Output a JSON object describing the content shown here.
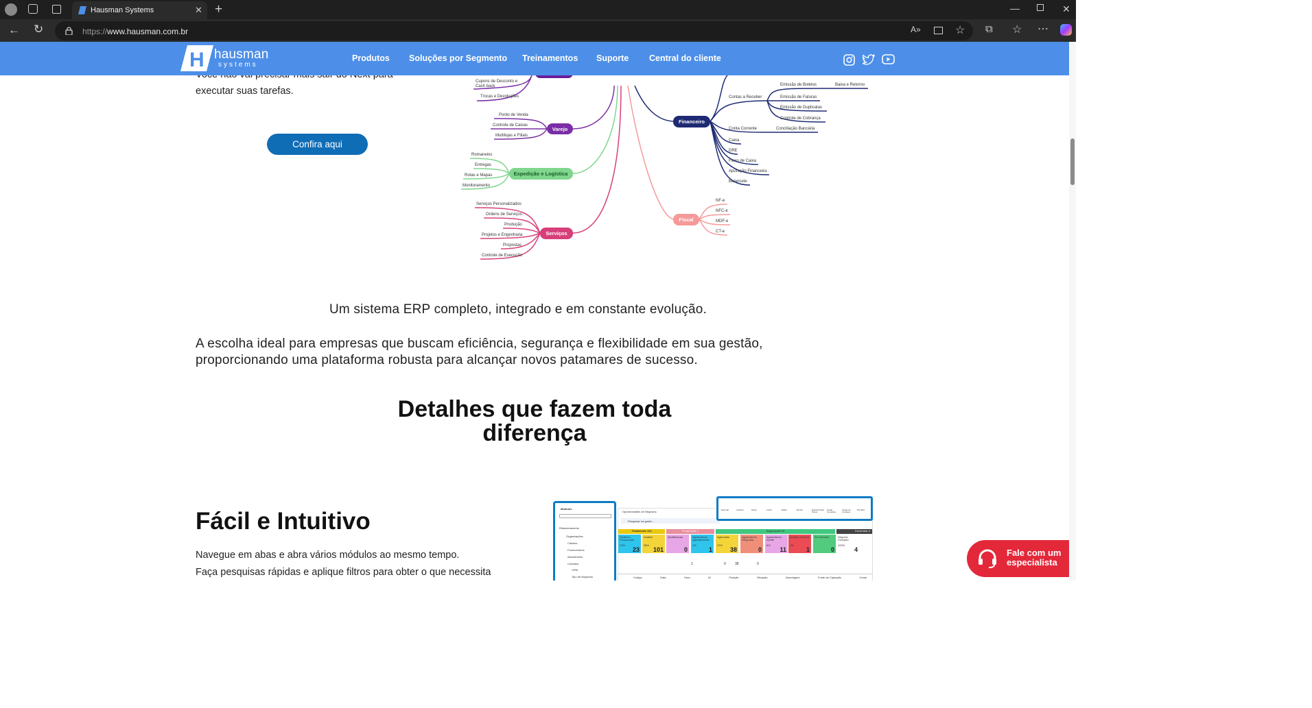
{
  "browser": {
    "tab_title": "Hausman Systems",
    "url_scheme": "https://",
    "url_host": "www.hausman.com.br"
  },
  "nav": {
    "logo_name": "hausman",
    "logo_sub": "systems",
    "items": [
      "Produtos",
      "Soluções por Segmento",
      "Treinamentos",
      "Suporte",
      "Central do cliente"
    ],
    "social": [
      "instagram-icon",
      "twitter-icon",
      "youtube-icon"
    ]
  },
  "intro": {
    "line1": "Você não vai precisar mais sair do Next para",
    "line2": "executar suas tarefas.",
    "button": "Confira aqui"
  },
  "mindmap": {
    "left_top_items": [
      "Cupons de Desconto e",
      "Cash back",
      "Trocas e Devoluções"
    ],
    "varejo": {
      "label": "Varejo",
      "items": [
        "Ponto de Venda",
        "Controle de Caixas",
        "Multilojas e Filiais"
      ]
    },
    "expedicao": {
      "label": "Expedição e Logística",
      "items": [
        "Romaneios",
        "Entregas",
        "Rotas e Mapas",
        "Monitoramento"
      ]
    },
    "servicos": {
      "label": "Serviços",
      "items": [
        "Serviços Personalizados",
        "Ordens de Serviços",
        "Produção",
        "Projetos e Engenharia",
        "Propostas",
        "Controle de Execução"
      ]
    },
    "financeiro": {
      "label": "Financeiro",
      "receber": "Contas a Receber",
      "receber_items": [
        "Emissão de Boletos",
        "Emissão de Faturas",
        "Emissão de Duplicatas",
        "Controle de Cobrança"
      ],
      "baixa": "Baixa e Retorno",
      "conta_corrente": "Conta Corrente",
      "conciliacao": "Conciliação Bancária",
      "items": [
        "Caixa",
        "DRE",
        "Fluxo de Caixa",
        "Apuração Financeira",
        "Balancete"
      ]
    },
    "fiscal": {
      "label": "Fiscal",
      "items": [
        "NF-e",
        "NFC-e",
        "MDF-e",
        "CT-e"
      ]
    }
  },
  "content": {
    "lead1": "Um sistema ERP completo, integrado e em constante evolução.",
    "lead2a": "A escolha ideal para empresas que buscam eficiência, segurança e flexibilidade em sua gestão,",
    "lead2b": "proporcionando uma plataforma robusta para alcançar novos patamares de sucesso.",
    "heading1": "Detalhes que fazem toda",
    "heading2": "diferença",
    "feature_title": "Fácil e Intuitivo",
    "feature_p1": "Navegue em abas e abra vários módulos ao mesmo tempo.",
    "feature_p2": "Faça pesquisas rápidas e aplique filtros para obter o que necessita"
  },
  "screenshot": {
    "modules_title": "Módulos",
    "tree": [
      "Relacionamento",
      "Organizações",
      "Clientes",
      "Fornecedores",
      "Atendimento",
      "Contatos",
      "CRM",
      "Tipo de Negócios"
    ],
    "tab": "Oportunidades de Negócios",
    "search": "Pesquisar na grade...",
    "toolbar": [
      "Exportar",
      "Imprimir",
      "Filtrar",
      "Incluir",
      "Editar",
      "Excluir",
      "Exibir/Ocultar Painel",
      "Grade Completa",
      "Grade de Contatos",
      "Pré-filtro"
    ],
    "stages": [
      {
        "label": "Tratamento 124",
        "color": "#e9c90f"
      },
      {
        "label": "Prospecção 1",
        "color": "#e98e9b"
      },
      {
        "label": "Negociação 50",
        "color": "#40c780"
      },
      {
        "label": "Encerrado 4",
        "color": "#444444"
      }
    ],
    "cards": [
      {
        "t": "Reativos Prospecção",
        "p": "13%",
        "n": "23",
        "c": "#2ec4ec"
      },
      {
        "t": "Análise",
        "p": "38%",
        "n": "101",
        "c": "#f3d53a"
      },
      {
        "t": "Qualificacao",
        "p": "",
        "n": "0",
        "c": "#e7a6e6"
      },
      {
        "t": "Aguardando agendamento",
        "p": "1%",
        "n": "1",
        "c": "#2ec4ec"
      },
      {
        "t": "Agendado",
        "p": "22%",
        "n": "38",
        "c": "#f3d53a"
      },
      {
        "t": "Aguardando Resposta",
        "p": "",
        "n": "0",
        "c": "#ef8f7a"
      },
      {
        "t": "Aguardando Aceite",
        "p": "6%",
        "n": "11",
        "c": "#e7a6e6"
      },
      {
        "t": "Análise Gerente",
        "p": "1%",
        "n": "1",
        "c": "#ea4b55"
      },
      {
        "t": "Em Revisão",
        "p": "",
        "n": "0",
        "c": "#52cb7e"
      },
      {
        "t": "Negócio Fechado",
        "p": "100%",
        "n": "4",
        "c": "#ffffff"
      }
    ],
    "summary": [
      "1",
      "0",
      "38",
      "0"
    ],
    "columns": [
      "Código",
      "Data",
      "Hora",
      "ID",
      "Posição",
      "Situação",
      "Abordagem",
      "Fonte de Captação",
      "Canal"
    ]
  },
  "cta": {
    "line1": "Fale com um",
    "line2": "especialista"
  }
}
